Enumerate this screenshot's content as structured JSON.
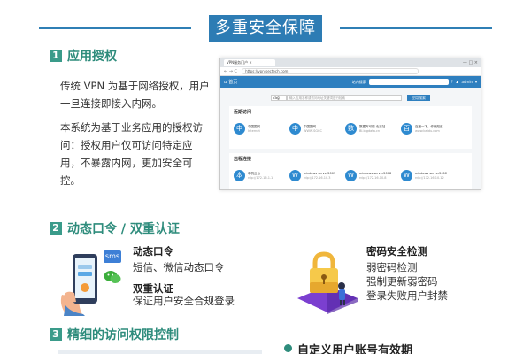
{
  "banner": {
    "title": "多重安全保障"
  },
  "section1": {
    "num": "1",
    "title": "应用授权",
    "para1": "传统 VPN 为基于网络授权，用户一旦连接即接入内网。",
    "para2": "本系统为基于业务应用的授权访问：授权用户仅可访问特定应用，不暴露内网，更加安全可控。"
  },
  "browser": {
    "tab_label": "VPN服务门户 ×",
    "window_controls": "— □ ×",
    "nav_arrows": "← → C",
    "url": "https://vpn.sectech.com",
    "home": "首页",
    "nav_search_label": "站内搜索",
    "user": "admin",
    "select_value": "ESg",
    "search_placeholder": "输入应用名称或访问地址关键词进行检索",
    "search_button": "应用搜索",
    "recent_title": "近期访问",
    "recent": [
      {
        "icon": "中",
        "name": "中国国网",
        "sub": "Internet"
      },
      {
        "icon": "中",
        "name": "中国国网",
        "sub": "WWW.SGCC"
      },
      {
        "icon": "数",
        "name": "数据库可视-北京站",
        "sub": "BI.bigdata.cn"
      },
      {
        "icon": "百",
        "name": "百度一下，你就知道",
        "sub": "www.baidu.com"
      }
    ],
    "remote_title": "远程连接",
    "remote": [
      {
        "icon": "本",
        "name": "本机云台",
        "sub": "rdp://172.16.1.1"
      },
      {
        "icon": "W",
        "name": "windows server2003",
        "sub": "rdp://172.16.10.3"
      },
      {
        "icon": "W",
        "name": "windows server2008",
        "sub": "rdp://172.16.10.8"
      },
      {
        "icon": "W",
        "name": "windows server2012",
        "sub": "rdp://172.16.10.12"
      }
    ]
  },
  "section2": {
    "num": "2",
    "title": "动态口令 / 双重认证",
    "sms_badge": "sms",
    "otp_title": "动态口令",
    "otp_desc": "短信、微信动态口令",
    "twofa_title": "双重认证",
    "twofa_desc": "保证用户安全合规登录",
    "pwd_title": "密码安全检测",
    "pwd_lines": [
      "弱密码检测",
      "强制更新弱密码",
      "登录失败用户封禁"
    ]
  },
  "section3": {
    "num": "3",
    "title": "精细的访问权限控制",
    "right_heading": "自定义用户账号有效期"
  },
  "colors": {
    "banner": "#2d7cb4",
    "section_accent": "#3a9b8a",
    "browser_nav": "#2e7fbf"
  }
}
